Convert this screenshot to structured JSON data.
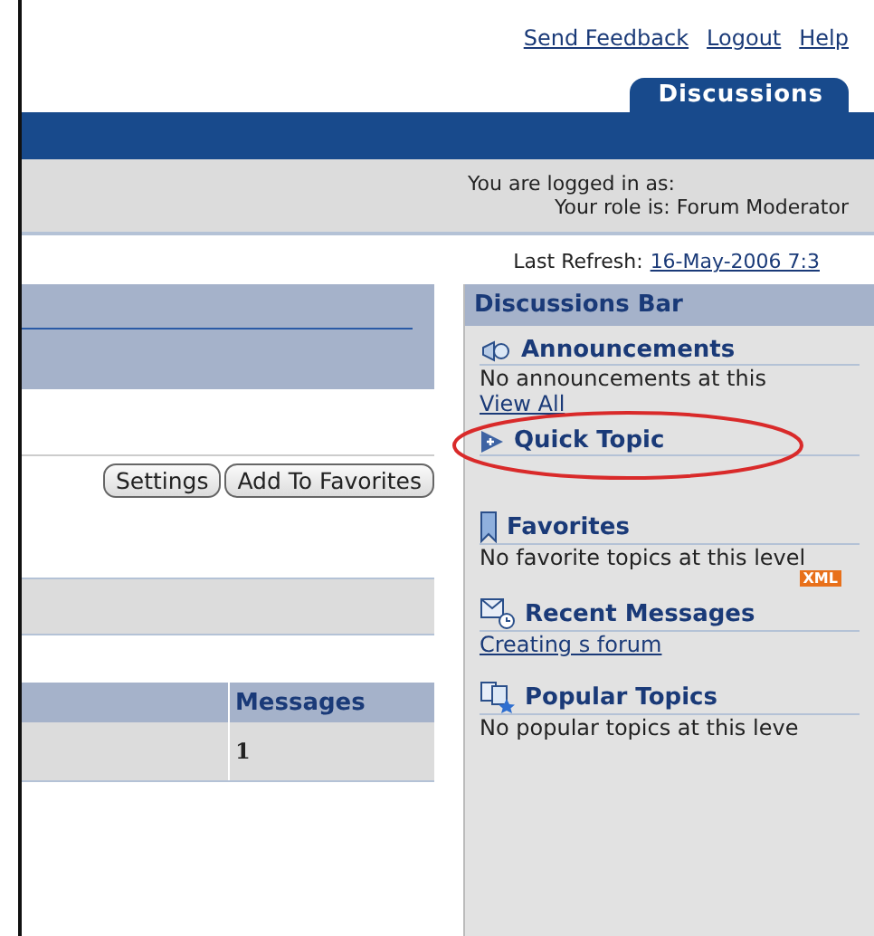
{
  "header_links": [
    {
      "label": "Send Feedback"
    },
    {
      "label": "Logout"
    },
    {
      "label": "Help"
    }
  ],
  "tabs": [
    {
      "label": "Discussions",
      "selected": true
    }
  ],
  "login_info": {
    "line_1": "You are logged in as:",
    "line_2": "Your role is: Forum Moderator"
  },
  "last_refresh": {
    "label": "Last Refresh:",
    "value": "16-May-2006 7:3"
  },
  "buttons": [
    "Settings",
    "Add To Favorites"
  ],
  "table": {
    "columns": [
      "",
      "Messages"
    ],
    "rows": [
      [
        "",
        "1"
      ]
    ]
  },
  "sidebar": {
    "title": "Discussions Bar",
    "sections": [
      {
        "kind": "announcements",
        "title": "Announcements",
        "text": "No announcements at this",
        "link": "View All"
      },
      {
        "kind": "quick_topic",
        "title": "Quick Topic",
        "highlighted": true
      },
      {
        "kind": "favorites",
        "title": "Favorites",
        "text": "No favorite topics at this level",
        "badge": "XML"
      },
      {
        "kind": "recent",
        "title": "Recent Messages",
        "link": "Creating s forum"
      },
      {
        "kind": "popular",
        "title": "Popular Topics",
        "text": "No popular topics at this leve"
      }
    ]
  }
}
